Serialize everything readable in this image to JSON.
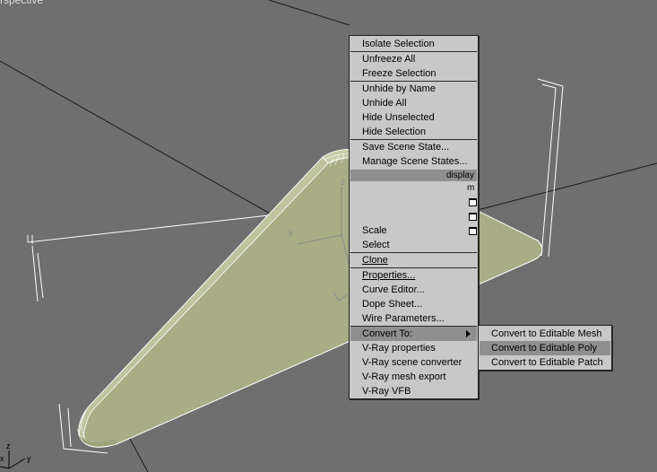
{
  "viewport": {
    "label": "rspective",
    "axis_x": "x",
    "axis_y": "y",
    "axis_z": "z",
    "gizmo_y": "y",
    "gizmo_z": "z"
  },
  "menu": {
    "group1": [
      "Isolate Selection"
    ],
    "group2": [
      "Unfreeze All",
      "Freeze Selection"
    ],
    "group3": [
      "Unhide by Name",
      "Unhide All",
      "Hide Unselected",
      "Hide Selection"
    ],
    "group4": [
      "Save Scene State...",
      "Manage Scene States..."
    ],
    "quad_header": "display",
    "quad_tag": "m",
    "group5": [
      "Scale",
      "Select"
    ],
    "clone": "Clone",
    "group6": [
      "Properties...",
      "Curve Editor...",
      "Dope Sheet...",
      "Wire Parameters..."
    ],
    "convert_to": "Convert To:",
    "group7": [
      "V-Ray properties",
      "V-Ray scene converter",
      "V-Ray mesh export",
      "V-Ray VFB"
    ]
  },
  "submenu": {
    "items": [
      "Convert to Editable Mesh",
      "Convert to Editable Poly",
      "Convert to Editable Patch"
    ],
    "highlighted_index": 1
  },
  "colors": {
    "viewport_bg": "#6f6f6f",
    "menu_bg": "#c8c8c8",
    "highlight": "#8f8f8f",
    "object_fill": "#a8ad85"
  }
}
